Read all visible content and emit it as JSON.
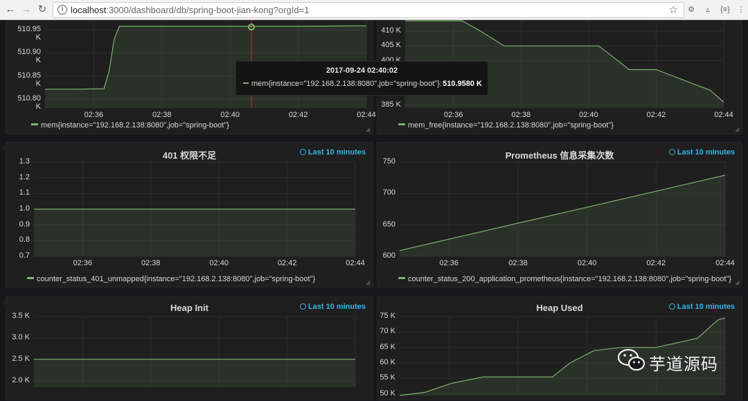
{
  "browser": {
    "url_host": "localhost",
    "url_rest": ":3000/dashboard/db/spring-boot-jian-kong?orgId=1"
  },
  "colors": {
    "series": "#7eb26d",
    "time_info": "#33b5e5",
    "background": "#161719",
    "panel": "#1f1f20"
  },
  "tooltip": {
    "time": "2017-09-24 02:40:02",
    "series": "mem{instance=\"192.168.2.138:8080\",job=\"spring-boot\"}:",
    "value": "510.9580 K"
  },
  "watermark": {
    "text": "芋道源码",
    "icon": "wechat-icon"
  },
  "x_ticks": [
    "02:36",
    "02:38",
    "02:40",
    "02:42",
    "02:44"
  ],
  "panels": [
    {
      "id": "mem",
      "title": "",
      "time_info": "",
      "legend": "mem{instance=\"192.168.2.138:8080\",job=\"spring-boot\"}",
      "chart_data": {
        "type": "area",
        "y_ticks": [
          "510.80 K",
          "510.85 K",
          "510.90 K",
          "510.95 K"
        ],
        "ylim": [
          510.78,
          510.97
        ],
        "xlim": [
          2.57,
          12.0
        ],
        "x": [
          2.57,
          3.5,
          4.3,
          4.45,
          4.6,
          4.75,
          4.9,
          5.4,
          8.0,
          10.0,
          11.7,
          12.0
        ],
        "y": [
          510.821,
          510.821,
          510.822,
          510.86,
          510.93,
          510.958,
          510.958,
          510.958,
          510.958,
          510.958,
          510.959,
          510.959
        ],
        "grid": true
      }
    },
    {
      "id": "mem_free",
      "title": "",
      "time_info": "",
      "legend": "mem_free{instance=\"192.168.2.138:8080\",job=\"spring-boot\"}",
      "chart_data": {
        "type": "area",
        "y_ticks": [
          "385 K",
          "400 K",
          "405 K",
          "410 K"
        ],
        "ylim": [
          384,
          413.5
        ],
        "xlim": [
          2.57,
          12.0
        ],
        "x": [
          2.57,
          4.25,
          4.8,
          5.5,
          8.3,
          9.2,
          10.0,
          11.6,
          12.0
        ],
        "y": [
          414,
          414,
          410,
          405,
          405,
          397,
          397,
          390,
          386
        ],
        "grid": true
      }
    },
    {
      "id": "status401",
      "title": "401 权限不足",
      "time_info": "Last 10 minutes",
      "legend": "counter_status_401_unmapped{instance=\"192.168.2.138:8080\",job=\"spring-boot\"}",
      "chart_data": {
        "type": "area",
        "y_ticks": [
          "0.7",
          "0.8",
          "0.9",
          "1.0",
          "1.1",
          "1.2",
          "1.3"
        ],
        "ylim": [
          0.7,
          1.3
        ],
        "xlim": [
          2.57,
          12.0
        ],
        "x": [
          2.57,
          12.0
        ],
        "y": [
          1.0,
          1.0
        ],
        "grid": true
      }
    },
    {
      "id": "prometheus",
      "title": "Prometheus 信息采集次数",
      "time_info": "Last 10 minutes",
      "legend": "counter_status_200_application_prometheus{instance=\"192.168.2.138:8080\",job=\"spring-boot\"}",
      "chart_data": {
        "type": "area",
        "y_ticks": [
          "600",
          "650",
          "700",
          "750"
        ],
        "ylim": [
          600,
          750
        ],
        "xlim": [
          2.57,
          12.0
        ],
        "x": [
          2.57,
          12.0
        ],
        "y": [
          609,
          729
        ],
        "grid": true
      }
    },
    {
      "id": "heap_init",
      "title": "Heap Init",
      "time_info": "Last 10 minutes",
      "legend": "",
      "chart_data": {
        "type": "area",
        "y_ticks": [
          "2.0 K",
          "2.5 K",
          "3.0 K",
          "3.5 K"
        ],
        "ylim": [
          1.85,
          3.5
        ],
        "xlim": [
          2.57,
          12.0
        ],
        "x": [
          2.57,
          12.0
        ],
        "y": [
          2.5,
          2.5
        ],
        "grid": true
      }
    },
    {
      "id": "heap_used",
      "title": "Heap Used",
      "time_info": "Last 10 minutes",
      "legend": "",
      "chart_data": {
        "type": "area",
        "y_ticks": [
          "50 K",
          "55 K",
          "60 K",
          "65 K",
          "70 K",
          "75 K"
        ],
        "ylim": [
          49.5,
          75
        ],
        "xlim": [
          2.57,
          12.0
        ],
        "x": [
          2.57,
          3.3,
          4.1,
          5.0,
          7.0,
          7.5,
          8.2,
          9.0,
          10.0,
          11.2,
          11.8,
          12.0
        ],
        "y": [
          49.5,
          50.5,
          53.5,
          55.5,
          55.5,
          60,
          64,
          65,
          65,
          68,
          74,
          74.5
        ],
        "grid": true
      }
    }
  ]
}
